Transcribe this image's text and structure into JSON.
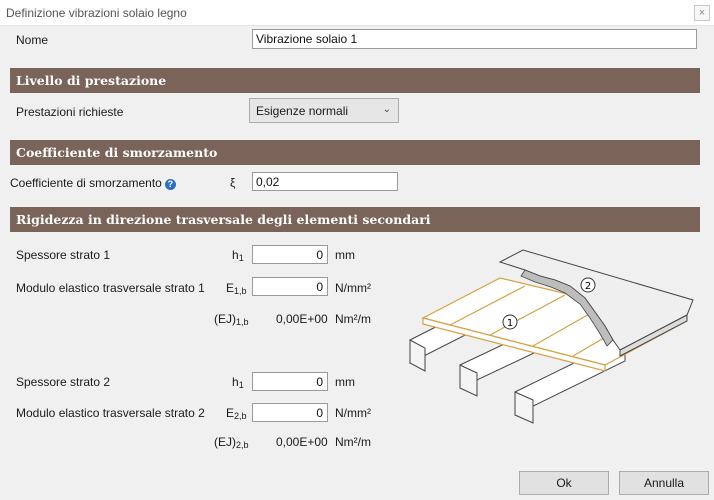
{
  "window": {
    "title": "Definizione vibrazioni solaio legno",
    "close_glyph": "×"
  },
  "nome": {
    "label": "Nome",
    "value": "Vibrazione solaio 1"
  },
  "sections": {
    "livello": "Livello di prestazione",
    "coefficiente": "Coefficiente di smorzamento",
    "rigidezza": "Rigidezza in direzione trasversale degli elementi secondari"
  },
  "prestazioni": {
    "label": "Prestazioni richieste",
    "selected": "Esigenze normali"
  },
  "smorzamento": {
    "label": "Coefficiente di smorzamento",
    "symbol": "ξ",
    "value": "0,02"
  },
  "strato1": {
    "spessore_label": "Spessore strato 1",
    "spessore_symbol": "h",
    "spessore_sub": "1",
    "spessore_value": "0",
    "spessore_unit": "mm",
    "modulo_label": "Modulo elastico trasversale strato 1",
    "modulo_symbol": "E",
    "modulo_sub": "1,b",
    "modulo_value": "0",
    "modulo_unit": "N/mm²",
    "ej_symbol": "(EJ)",
    "ej_sub": "1,b",
    "ej_value": "0,00E+00",
    "ej_unit": "Nm²/m"
  },
  "strato2": {
    "spessore_label": "Spessore strato 2",
    "spessore_symbol": "h",
    "spessore_sub": "1",
    "spessore_value": "0",
    "spessore_unit": "mm",
    "modulo_label": "Modulo elastico trasversale strato 2",
    "modulo_symbol": "E",
    "modulo_sub": "2,b",
    "modulo_value": "0",
    "modulo_unit": "N/mm²",
    "ej_symbol": "(EJ)",
    "ej_sub": "2,b",
    "ej_value": "0,00E+00",
    "ej_unit": "Nm²/m"
  },
  "illustration": {
    "marker1": "1",
    "marker2": "2",
    "wood_color": "#d8a040",
    "outline_color": "#444444"
  },
  "buttons": {
    "ok": "Ok",
    "cancel": "Annulla"
  },
  "icons": {
    "info": "?",
    "caret": "⌄"
  }
}
